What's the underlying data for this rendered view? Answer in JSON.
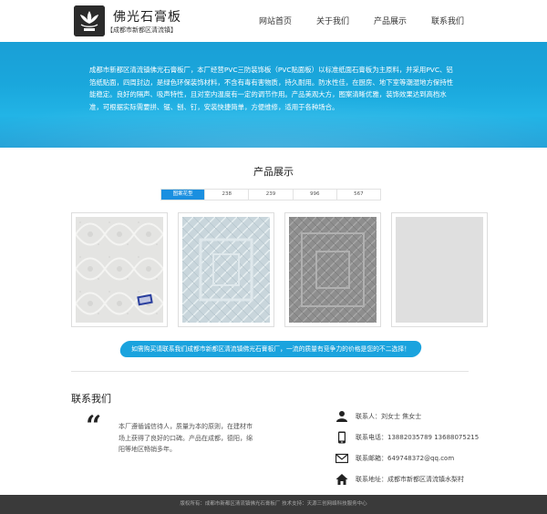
{
  "brand": {
    "name": "佛光石膏板",
    "subtitle": "【成都市新都区清流镇】"
  },
  "nav": [
    "网站首页",
    "关于我们",
    "产品展示",
    "联系我们"
  ],
  "hero": {
    "text": "成都市新都区清流镇佛光石膏板厂，本厂经营PVC三防装饰板（PVC贴面板）以标准纸面石膏板为主原料，并采用PVC、铝箔纸贴面，四周封边，是绿色环保装饰材料，不含有毒有害物质，持久耐用。防水性佳，在厨房、地下室等潮湿地方保持性能稳定。良好的隔声、吸声特性，且对室内温度有一定的调节作用。产品美观大方，图案清晰优雅，装饰效果达到高档水准，可根据实际需要拼、锯、刨、钉，安装快捷简单，方便维修，适用于各种场合。"
  },
  "products_section": {
    "title": "产品展示",
    "tabs": [
      "图案花型",
      "238",
      "239",
      "996",
      "567"
    ],
    "active_tab": 0
  },
  "banner": {
    "text": "如需购买请联系我们成都市新都区清流镇佛光石膏板厂，一流的质量有竞争力的价格是您的不二选择！"
  },
  "contact": {
    "title": "联系我们",
    "about": "本厂遵循诚信待人，质量为本的原则，在建材市场上获得了良好的口碑。产品在成都，德阳，绵阳等地区畅销多年。",
    "person_label": "联系人：",
    "person": "刘女士 焦女士",
    "phone_label": "联系电话：",
    "phone": "13882035789 13688075215",
    "email_label": "联系邮箱：",
    "email": "649748372@qq.com",
    "address_label": "联系地址：",
    "address": "成都市新都区清流镇水梨村"
  },
  "footer": {
    "text": "版权所有：成都市新都区清流镇佛光石膏板厂 技术支持：天源三创网络科技服务中心"
  },
  "colors": {
    "accent": "#1a8fe0",
    "hero": "#1aa7dc",
    "footer": "#3a3a3a"
  }
}
